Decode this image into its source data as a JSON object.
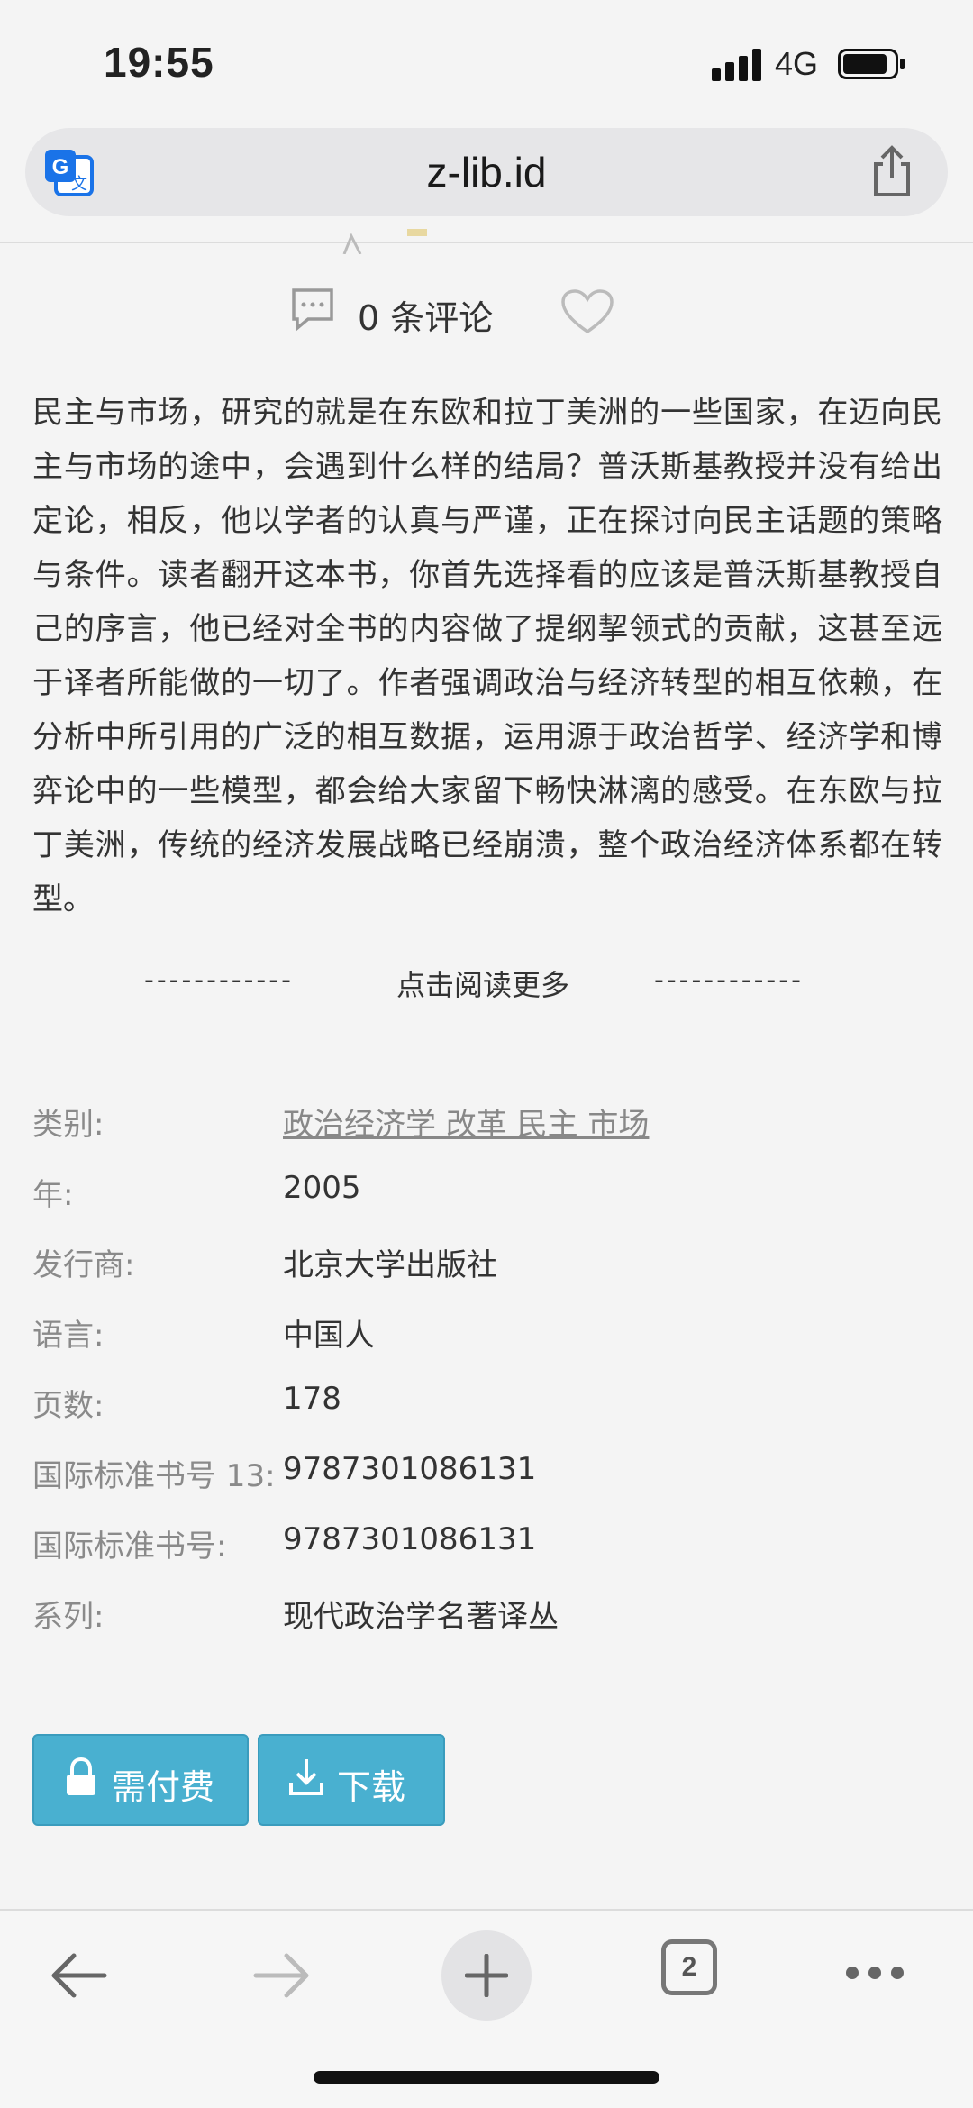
{
  "status_bar": {
    "time": "19:55",
    "network": "4G"
  },
  "browser": {
    "url": "z-lib.id",
    "tab_count": "2"
  },
  "book": {
    "comments": "0 条评论",
    "description": "民主与市场，研究的就是在东欧和拉丁美洲的一些国家，在迈向民主与市场的途中，会遇到什么样的结局？普沃斯基教授并没有给出定论，相反，他以学者的认真与严谨，正在探讨向民主话题的策略与条件。读者翻开这本书，你首先选择看的应该是普沃斯基教授自己的序言，他已经对全书的内容做了提纲挈领式的贡献，这甚至远于译者所能做的一切了。作者强调政治与经济转型的相互依赖，在分析中所引用的广泛的相互数据，运用源于政治哲学、经济学和博弈论中的一些模型，都会给大家留下畅快淋漓的感受。在东欧与拉丁美洲，传统的经济发展战略已经崩溃，整个政治经济体系都在转型。",
    "read_more": "点击阅读更多",
    "read_more_dashes": "------------",
    "details": [
      {
        "label": "类别:",
        "value": "政治经济学 改革 民主 市场"
      },
      {
        "label": "年:",
        "value": "2005"
      },
      {
        "label": "发行商:",
        "value": "北京大学出版社"
      },
      {
        "label": "语言:",
        "value": "中国人"
      },
      {
        "label": "页数:",
        "value": "178"
      },
      {
        "label": "国际标准书号 13:",
        "value": "9787301086131"
      },
      {
        "label": "国际标准书号:",
        "value": "9787301086131"
      },
      {
        "label": "系列:",
        "value": "现代政治学名著译丛"
      }
    ]
  },
  "buttons": {
    "pay": "需付费",
    "download": "下载"
  },
  "icons": {
    "translate": "translate-icon",
    "share": "share-icon",
    "comment": "comment-icon",
    "heart": "heart-icon",
    "lock": "lock-icon",
    "download": "download-icon",
    "back": "back-arrow-icon",
    "forward": "forward-arrow-icon",
    "plus": "plus-icon",
    "more": "more-icon",
    "star": "star-icon"
  },
  "colors": {
    "button": "#49b0d0",
    "link": "#888888",
    "background": "#f4f4f4"
  }
}
